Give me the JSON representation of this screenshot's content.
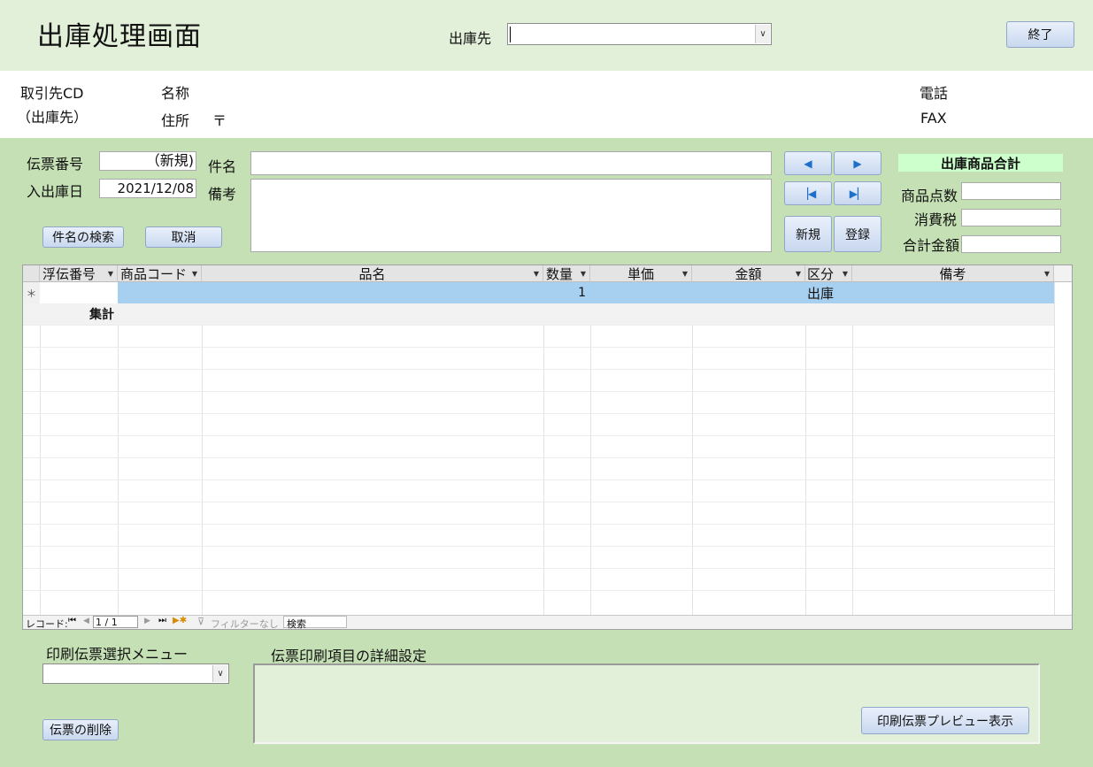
{
  "header": {
    "title": "出庫処理画面",
    "destination_label": "出庫先",
    "destination_value": "",
    "exit_button": "終了"
  },
  "info": {
    "client_cd_label": "取引先CD",
    "client_sub_label": "（出庫先）",
    "name_label": "名称",
    "address_label": "住所",
    "postal_mark": "〒",
    "phone_label": "電話",
    "fax_label": "FAX"
  },
  "form": {
    "slip_no_label": "伝票番号",
    "slip_no_value": "（新規)",
    "date_label": "入出庫日",
    "date_value": "2021/12/08",
    "subject_label": "件名",
    "subject_value": "",
    "remarks_label": "備考",
    "remarks_value": "",
    "search_subject_button": "件名の検索",
    "cancel_button": "取消",
    "new_button": "新規",
    "register_button": "登録"
  },
  "nav": {
    "prev_icon": "◀",
    "next_icon": "▶",
    "first_icon": "▕◀",
    "last_icon": "▶▏"
  },
  "summary": {
    "heading": "出庫商品合計",
    "item_count_label": "商品点数",
    "tax_label": "消費税",
    "total_label": "合計金額",
    "item_count_value": "",
    "tax_value": "",
    "total_value": ""
  },
  "grid": {
    "columns": [
      "浮伝番号",
      "商品コード",
      "品名",
      "数量",
      "単価",
      "金額",
      "区分",
      "備考"
    ],
    "new_row_marker": "＊",
    "new_row": {
      "quantity": "1",
      "category": "出庫"
    },
    "total_row_label": "集計"
  },
  "status_bar": {
    "record_label": "レコード:",
    "record_position": "1 / 1",
    "filter_label": "フィルターなし",
    "search_label": "検索"
  },
  "print": {
    "menu_label": "印刷伝票選択メニュー",
    "menu_value": "",
    "detail_label": "伝票印刷項目の詳細設定",
    "delete_button": "伝票の削除",
    "preview_button": "印刷伝票プレビュー表示"
  }
}
